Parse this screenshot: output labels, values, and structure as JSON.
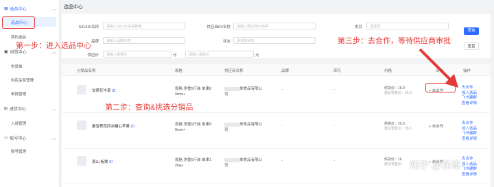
{
  "sidebar": {
    "groups": [
      {
        "label": "选品中心",
        "icon": "grid-icon",
        "children": [
          "选品中心",
          "我的选品"
        ]
      },
      {
        "label": "供货中心",
        "icon": "box-icon",
        "children": [
          "供货单",
          "供应关系管理",
          "审批管理"
        ]
      },
      {
        "label": "进货中心",
        "icon": "cart-icon",
        "children": [
          "入驻管理"
        ]
      },
      {
        "label": "账号中心",
        "icon": "user-icon",
        "children": [
          "账号管理"
        ]
      }
    ]
  },
  "page_title": "选品中心",
  "filters": {
    "sku_label": "SKUID/名称",
    "sku_placeholder": "请输入SKUID/名称搜索",
    "supplier_label": "供应商ID/名称",
    "supplier_placeholder": "请输入供应商ID/名称",
    "category_label": "类目",
    "category_placeholder": "请选择",
    "brand_label": "品牌",
    "brand_placeholder": "请输入品牌名称",
    "status_label": "状态",
    "status_placeholder": "请选择状态",
    "price_label": "供应价",
    "price_min_placeholder": "请输入最低价",
    "price_unit": "元",
    "price_max_placeholder": "请输入最高价",
    "price_unit2": "元",
    "search_button": "查询",
    "reset_button": "重置"
  },
  "table": {
    "headers": [
      "分销品名称",
      "规格",
      "供应商名称",
      "品牌",
      "库存",
      "价格",
      "合作",
      "操作"
    ],
    "rows": [
      {
        "name": "甘蔗花牛草",
        "id_tag": "ID",
        "spec1": "规格:净重5斤装 单果8",
        "spec2": "0mm+",
        "supplier": "单食品有限公",
        "supplier2": "司",
        "brand": "-",
        "stock": "-",
        "price": "供货价：15.9",
        "price2": "建议零售价：25.9",
        "status": "+ 未合作",
        "actions": [
          "去合作",
          "加入选品",
          "飞书建群",
          "查看详情"
        ]
      },
      {
        "name": "聚宝杷花四冰糖心苹果",
        "id_tag": "ID",
        "spec1": "规格:净重5斤装 单果8",
        "spec2": "0mm+",
        "supplier": "单食品有限公",
        "supplier2": "司",
        "brand": "-",
        "stock": "-",
        "price": "供货价：25.6",
        "price2": "建议零售价：35.6",
        "status": "+ 未合作",
        "actions": [
          "去合作",
          "加入选品",
          "飞书建群",
          "查看详情"
        ]
      },
      {
        "name": "燕山 板栗",
        "id_tag": "ID",
        "spec1": "规格:净重5斤装 单果1",
        "spec2": "20g+",
        "supplier": "单食品有限公",
        "supplier2": "司",
        "brand": "-",
        "stock": "-",
        "price": "供货价：16",
        "price2": "建议零售价：",
        "status": "+ 未合作",
        "actions": [
          "去合作",
          "加入选品",
          "飞书建群",
          "查看详情"
        ]
      }
    ]
  },
  "annotations": {
    "step1": "第一步：进入选品中心",
    "step2": "第二步：查询&挑选分销品",
    "step3": "第三步：去合作，等待供应商审批"
  },
  "watermark": "知乎 @锋哥",
  "colors": {
    "accent": "#2f6bff",
    "annotation_red": "#e53935"
  }
}
